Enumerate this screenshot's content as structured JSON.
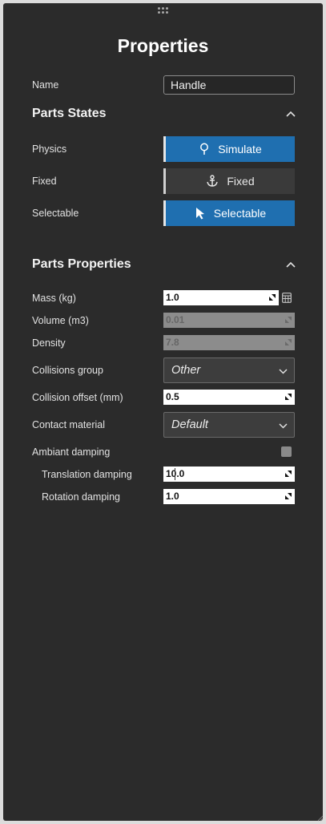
{
  "panel": {
    "title": "Properties"
  },
  "name_row": {
    "label": "Name",
    "value": "Handle"
  },
  "parts_states": {
    "header": "Parts States",
    "rows": [
      {
        "label": "Physics",
        "button": "Simulate",
        "icon": "pin-icon",
        "active": true
      },
      {
        "label": "Fixed",
        "button": "Fixed",
        "icon": "anchor-icon",
        "active": false
      },
      {
        "label": "Selectable",
        "button": "Selectable",
        "icon": "cursor-icon",
        "active": true
      }
    ]
  },
  "parts_properties": {
    "header": "Parts Properties",
    "mass": {
      "label": "Mass (kg)",
      "value": "1.0"
    },
    "volume": {
      "label": "Volume (m3)",
      "value": "0.01"
    },
    "density": {
      "label": "Density",
      "value": "7.8"
    },
    "collisions_group": {
      "label": "Collisions group",
      "value": "Other"
    },
    "collision_offset": {
      "label": "Collision offset (mm)",
      "value": "0.5"
    },
    "contact_material": {
      "label": "Contact material",
      "value": "Default"
    },
    "ambiant_damping": {
      "label": "Ambiant damping",
      "checked": false
    },
    "translation_damping": {
      "label": "Translation damping",
      "value": "10.0"
    },
    "rotation_damping": {
      "label": "Rotation damping",
      "value": "1.0"
    }
  },
  "colors": {
    "panel_bg": "#2b2b2b",
    "accent_blue": "#1f6fb0",
    "button_off": "#3a3a3a"
  }
}
